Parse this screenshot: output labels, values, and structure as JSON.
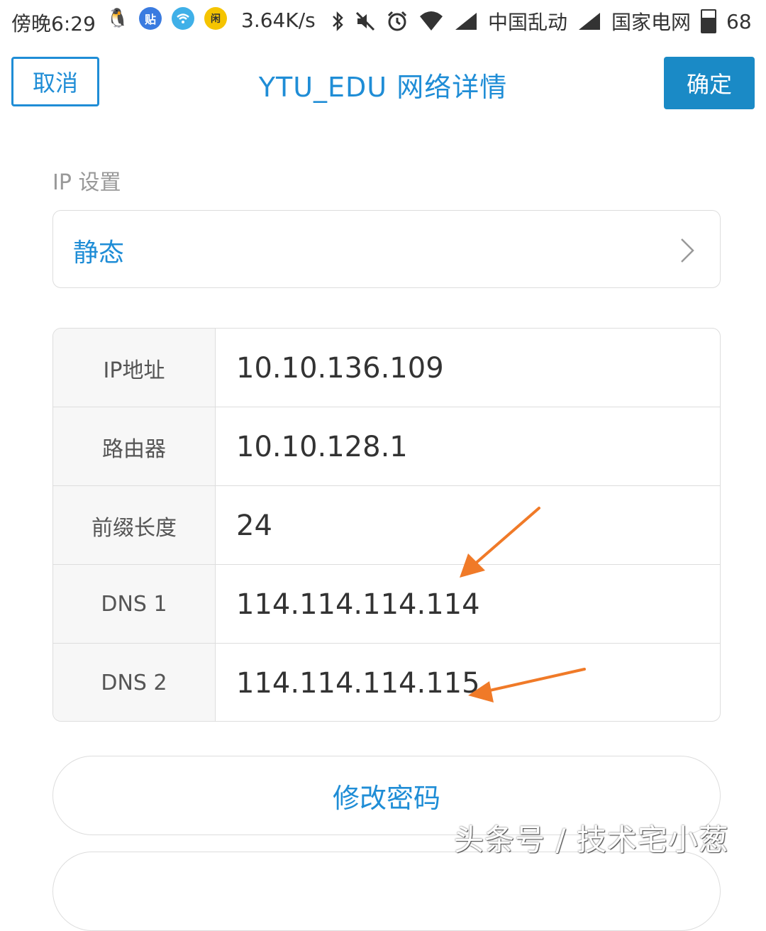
{
  "status_bar": {
    "time": "傍晚6:29",
    "apps": [
      {
        "icon": "qq-icon",
        "color": "#222222",
        "glyph": "🐧"
      },
      {
        "icon": "tieba-icon",
        "color": "#3a7be0",
        "glyph": "贴"
      },
      {
        "icon": "wifi-app-icon",
        "color": "#3fb0e8",
        "glyph": "◉"
      },
      {
        "icon": "xianyu-icon",
        "color": "#f5c400",
        "glyph": "闲"
      }
    ],
    "speed": "3.64K/s",
    "carrier1": "中国乱动",
    "carrier2": "国家电网",
    "battery": "68"
  },
  "header": {
    "cancel_label": "取消",
    "title": "YTU_EDU  网络详情",
    "confirm_label": "确定",
    "accent_color": "#1f8dd6"
  },
  "ip_settings": {
    "section_label": "IP 设置",
    "mode_value": "静态"
  },
  "details": [
    {
      "label": "IP地址",
      "value": "10.10.136.109"
    },
    {
      "label": "路由器",
      "value": "10.10.128.1"
    },
    {
      "label": "前缀长度",
      "value": "24"
    },
    {
      "label": "DNS 1",
      "value": "114.114.114.114"
    },
    {
      "label": "DNS 2",
      "value": "114.114.114.115"
    }
  ],
  "actions": {
    "change_password_label": "修改密码"
  },
  "watermark": "头条号 / 技术宅小葱",
  "annotation_color": "#f07a28"
}
